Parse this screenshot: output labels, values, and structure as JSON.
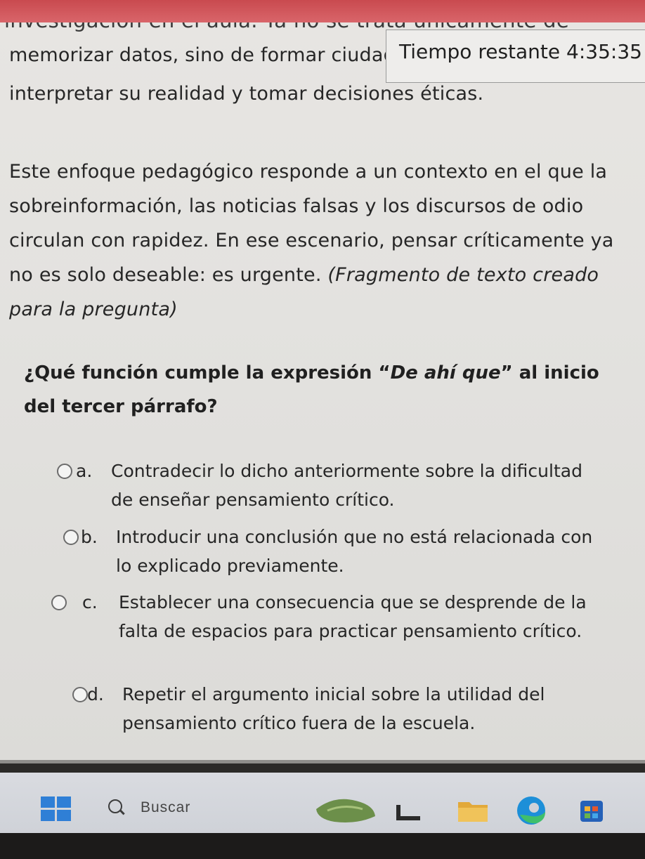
{
  "page_text": {
    "cut_top_line": "investigación en el aula. Ya no se trata únicamente de",
    "line_1": "memorizar datos, sino de formar ciudadanos capaces de",
    "line_2": "interpretar su realidad y tomar decisiones éticas.",
    "paragraph_2": "Este enfoque pedagógico responde a un contexto en el que la sobreinformación, las noticias falsas y los discursos de odio circulan con rapidez. En ese escenario, pensar críticamente ya no es solo deseable: es urgente.",
    "paragraph_2_note": "(Fragmento de texto creado para la pregunta)"
  },
  "timer": {
    "label": "Tiempo restante",
    "value": "4:35:35"
  },
  "question": {
    "prefix": "¿Qué función cumple la expresión “",
    "highlight": "De ahí que",
    "suffix": "” al inicio del tercer párrafo?"
  },
  "options": [
    {
      "letter": "a.",
      "text": "Contradecir lo dicho anteriormente sobre la dificultad de enseñar pensamiento crítico."
    },
    {
      "letter": "b.",
      "text": "Introducir una conclusión que no está relacionada con lo explicado previamente."
    },
    {
      "letter": "c.",
      "text": "Establecer una consecuencia que se desprende de la falta de espacios para practicar pensamiento crítico."
    },
    {
      "letter": "d.",
      "text": "Repetir el argumento inicial sobre la utilidad del pensamiento crítico fuera de la escuela."
    }
  ],
  "taskbar": {
    "search_label": "Buscar",
    "icons": [
      "windows-start-icon",
      "search-icon",
      "widgets-icon",
      "task-view-icon",
      "file-explorer-icon",
      "edge-browser-icon",
      "store-icon"
    ]
  }
}
